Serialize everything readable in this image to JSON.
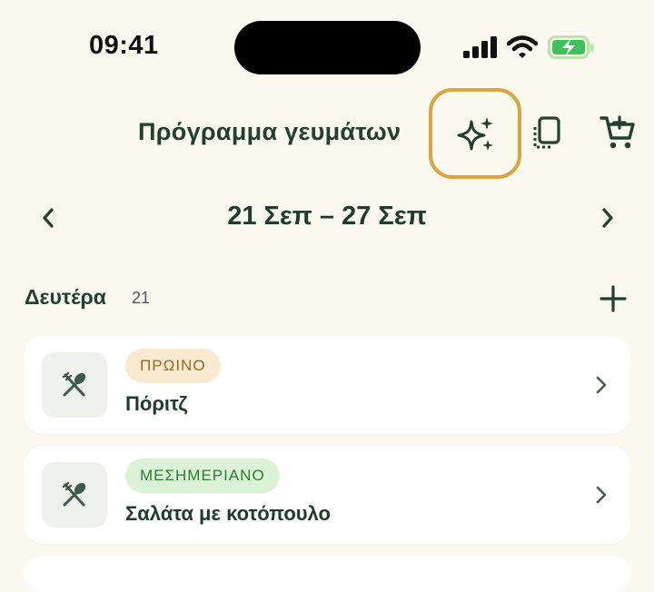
{
  "status_bar": {
    "time": "09:41"
  },
  "header": {
    "title": "Πρόγραμμα γευμάτων",
    "icons": [
      "sparkles-icon",
      "copy-icon",
      "cart-add-icon"
    ],
    "highlight_color": "#d9a540"
  },
  "week": {
    "range": "21 Σεπ – 27 Σεπ"
  },
  "day": {
    "name": "Δευτέρα",
    "number": "21",
    "meals": [
      {
        "type": "ΠΡΩΙΝΟ",
        "name": "Πόριτζ",
        "badge_color": "#fbead2"
      },
      {
        "type": "ΜΕΣΗΜΕΡΙΑΝΟ",
        "name": "Σαλάτα με κοτόπουλο",
        "badge_color": "#dbf2d7"
      }
    ]
  },
  "colors": {
    "background": "#fbf8ef",
    "primary": "#1f3b2c"
  }
}
